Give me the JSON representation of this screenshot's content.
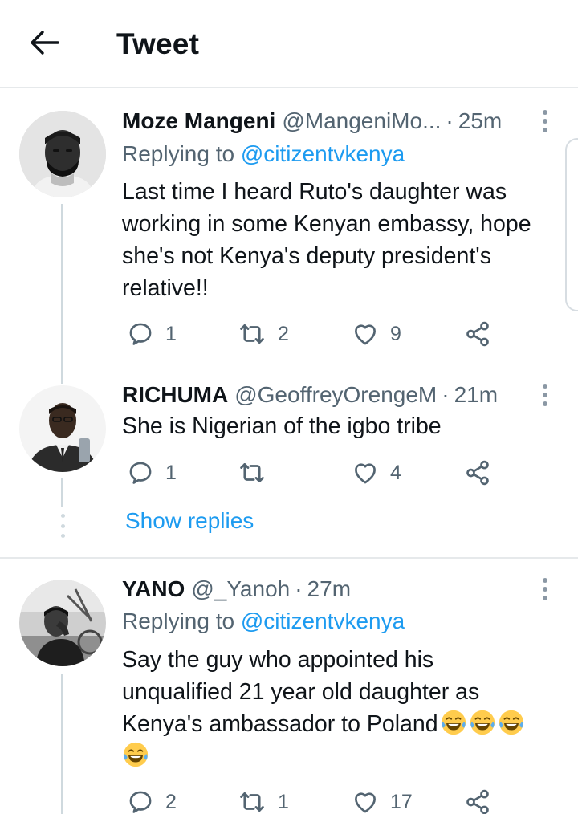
{
  "header": {
    "title": "Tweet",
    "back_icon": "arrow-left-icon"
  },
  "colors": {
    "accent": "#1d9bf0",
    "text_primary": "#0f1419",
    "text_secondary": "#536471",
    "divider": "#e6e9eb",
    "thread_line": "#cfd9de"
  },
  "tweets": [
    {
      "name": "Moze Mangeni",
      "handle": "@MangeniMo...",
      "separator": "·",
      "time": "25m",
      "replying_prefix": "Replying to",
      "replying_to": "@citizentvkenya",
      "text_lines": [
        "Last time I heard Ruto's daughter was",
        "working in some Kenyan embassy, hope",
        "she's not Kenya's deputy president's",
        "relative!!"
      ],
      "replies": "1",
      "retweets": "2",
      "likes": "9"
    },
    {
      "name": "RICHUMA",
      "handle": "@GeoffreyOrengeM",
      "separator": "·",
      "time": "21m",
      "text_lines": [
        "She is Nigerian of the igbo tribe"
      ],
      "replies": "1",
      "retweets": "",
      "likes": "4"
    },
    {
      "name": "YANO",
      "handle": "@_Yanoh",
      "separator": "·",
      "time": "27m",
      "replying_prefix": "Replying to",
      "replying_to": "@citizentvkenya",
      "text_lines": [
        "Say the guy who appointed his",
        "unqualified 21 year old daughter as",
        "Kenya's ambassador to Poland"
      ],
      "emoji": "face-with-tears-of-joy-icon",
      "replies": "2",
      "retweets": "1",
      "likes": "17"
    }
  ],
  "show_replies": "Show replies"
}
